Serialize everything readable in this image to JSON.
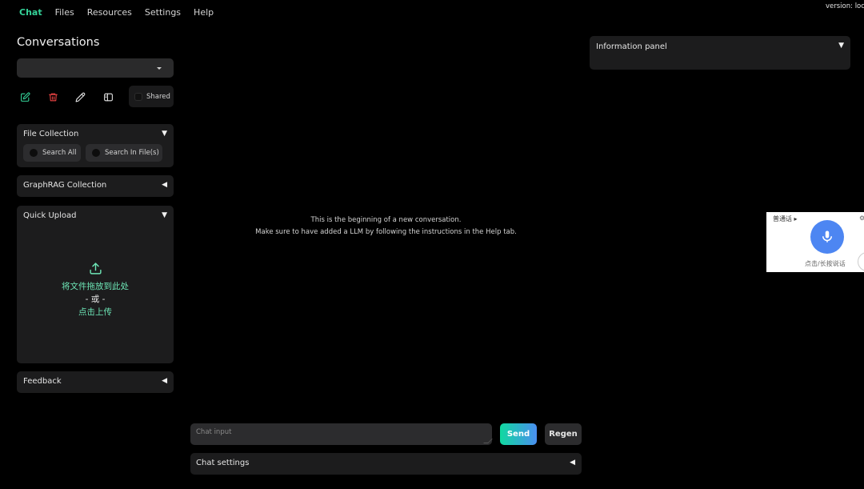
{
  "version": "version: local",
  "nav": {
    "tabs": [
      {
        "label": "Chat"
      },
      {
        "label": "Files"
      },
      {
        "label": "Resources"
      },
      {
        "label": "Settings"
      },
      {
        "label": "Help"
      }
    ]
  },
  "sidebar": {
    "title": "Conversations",
    "select_value": "",
    "shared_label": "Shared",
    "file_collection": {
      "title": "File Collection",
      "options": [
        "Search All",
        "Search In File(s)"
      ]
    },
    "graphrag": {
      "title": "GraphRAG Collection"
    },
    "quick_upload": {
      "title": "Quick Upload",
      "drop_text": "将文件拖放到此处",
      "or_text": "- 或 -",
      "click_text": "点击上传"
    },
    "feedback": {
      "title": "Feedback"
    }
  },
  "chat": {
    "intro_line1": "This is the beginning of a new conversation.",
    "intro_line2": "Make sure to have added a LLM by following the instructions in the Help tab.",
    "input_placeholder": "Chat input",
    "send_label": "Send",
    "regen_label": "Regen",
    "settings_title": "Chat settings"
  },
  "info_panel": {
    "title": "Information panel"
  },
  "voice_widget": {
    "lang": "普通话",
    "hint": "点击/长按说话"
  },
  "colors": {
    "accent": "#34d399",
    "delete": "#ef4444",
    "send_gradient_start": "#10d9a0",
    "send_gradient_end": "#4a8ef0",
    "mic": "#4d86f2"
  },
  "icons": {
    "new": "new-conversation-icon",
    "delete": "trash-icon",
    "rename": "pencil-icon",
    "sidebar": "sidebar-toggle-icon",
    "upload": "upload-icon",
    "mic": "microphone-icon",
    "collapse_down": "triangle-down",
    "collapse_left": "triangle-left"
  }
}
